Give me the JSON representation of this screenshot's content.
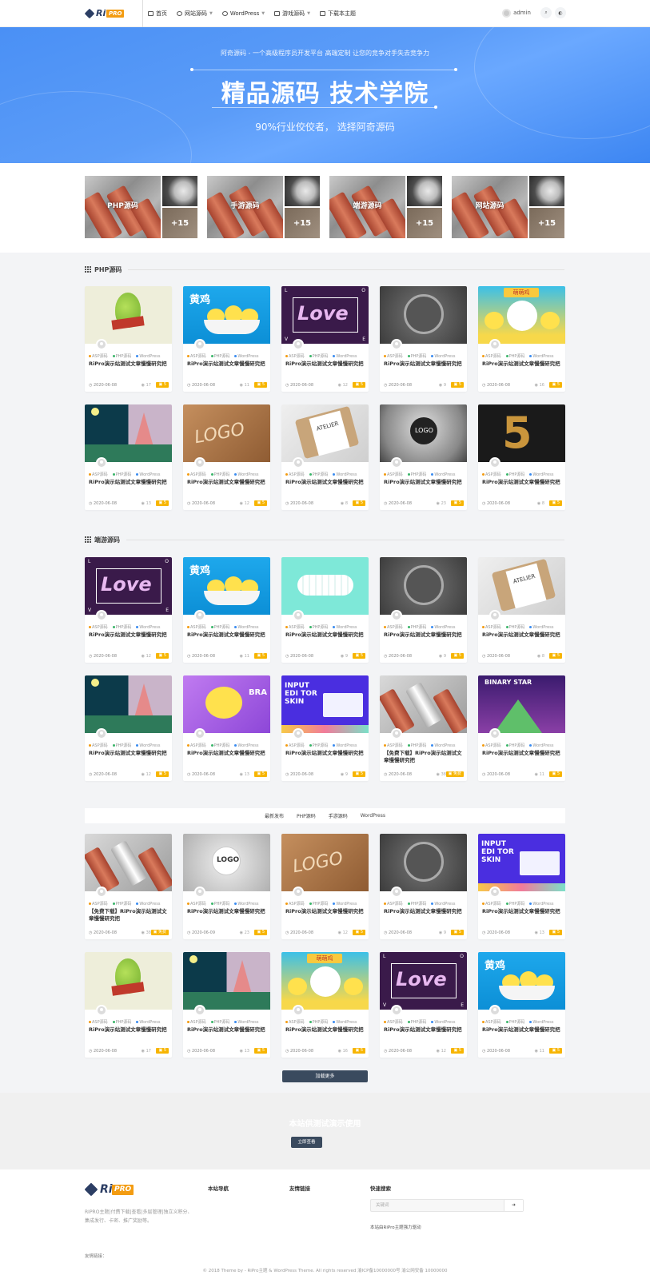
{
  "header": {
    "logo_ri": "Ri",
    "logo_pro": "PRO",
    "nav": [
      "首页",
      "网站源码",
      "WordPress",
      "游戏源码",
      "下载本主题"
    ],
    "user": "admin"
  },
  "hero": {
    "subtitle": "阿奇源码 - 一个高级程序员开发平台 高端定制 让您的竞争对手失去竞争力",
    "title": "精品源码 技术学院",
    "tagline": "90%行业佼佼者， 选择阿奇源码"
  },
  "categories": [
    {
      "label": "PHP源码",
      "count": "+15"
    },
    {
      "label": "手游源码",
      "count": "+15"
    },
    {
      "label": "端游源码",
      "count": "+15"
    },
    {
      "label": "网站源码",
      "count": "+15"
    }
  ],
  "sections": [
    {
      "title": "PHP源码"
    },
    {
      "title": "端游源码"
    }
  ],
  "post_cats": [
    "ASP源码",
    "PHP源码",
    "WordPress"
  ],
  "post_title": "RiPro演示站测试文章慢慢研究把",
  "post_title_free": "【免费下载】RiPro演示站测试文章慢慢研究把",
  "price": "5",
  "price_free": "免费",
  "grid1": [
    {
      "date": "2020-06-08",
      "views": "17"
    },
    {
      "date": "2020-06-08",
      "views": "11"
    },
    {
      "date": "2020-06-08",
      "views": "12"
    },
    {
      "date": "2020-06-08",
      "views": "9"
    },
    {
      "date": "2020-06-08",
      "views": "16"
    },
    {
      "date": "2020-06-08",
      "views": "13"
    },
    {
      "date": "2020-06-08",
      "views": "12"
    },
    {
      "date": "2020-06-08",
      "views": "8"
    },
    {
      "date": "2020-06-08",
      "views": "23"
    },
    {
      "date": "2020-06-08",
      "views": "8"
    }
  ],
  "grid2": [
    {
      "date": "2020-06-08",
      "views": "12"
    },
    {
      "date": "2020-06-08",
      "views": "11"
    },
    {
      "date": "2020-06-08",
      "views": "9"
    },
    {
      "date": "2020-06-08",
      "views": "9"
    },
    {
      "date": "2020-06-08",
      "views": "8"
    },
    {
      "date": "2020-06-08",
      "views": "12"
    },
    {
      "date": "2020-06-08",
      "views": "13"
    },
    {
      "date": "2020-06-08",
      "views": "9"
    },
    {
      "date": "2020-06-08",
      "views": "38"
    },
    {
      "date": "2020-06-08",
      "views": "11"
    }
  ],
  "tabs": [
    "最新发布",
    "PHP源码",
    "手游源码",
    "WordPress"
  ],
  "grid3": [
    {
      "date": "2020-06-08",
      "views": "38"
    },
    {
      "date": "2020-06-09",
      "views": "23"
    },
    {
      "date": "2020-06-08",
      "views": "12"
    },
    {
      "date": "2020-06-08",
      "views": "9"
    },
    {
      "date": "2020-06-08",
      "views": "13"
    },
    {
      "date": "2020-06-08",
      "views": "17"
    },
    {
      "date": "2020-06-08",
      "views": "13"
    },
    {
      "date": "2020-06-08",
      "views": "16"
    },
    {
      "date": "2020-06-08",
      "views": "12"
    },
    {
      "date": "2020-06-08",
      "views": "11"
    }
  ],
  "load_more": "加载更多",
  "cta": {
    "text": "本站供测试演示使用",
    "button": "立即查看",
    "alt": ""
  },
  "footer": {
    "desc": "RIPRO主题|付费下载|查看|多层管理|独立义积分、集成发行、卡密、推广奖励等。",
    "col1": "本站导航",
    "col2": "友情链接",
    "col3": "快速搜索",
    "search_placeholder": "关键词",
    "note": "本站由RiPro主题强力驱动",
    "links_label": "友情链接：",
    "copyright": "© 2018 Theme by -  RiPro主题 & WordPress Theme. All rights reserved  渝ICP备10000000号  渝公网安备 10000000"
  }
}
